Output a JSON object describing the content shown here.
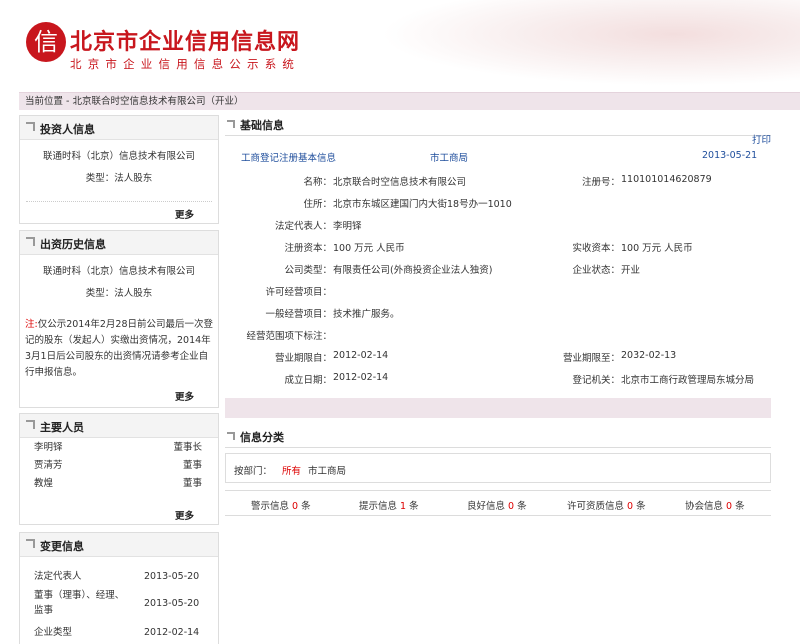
{
  "header": {
    "logo_char": "信",
    "title": "北京市企业信用信息网",
    "subtitle": "北京市企业信用信息公示系统"
  },
  "breadcrumb": "当前位置 - 北京联合时空信息技术有限公司（开业）",
  "left": {
    "investor": {
      "title": "投资人信息",
      "name": "联通时科（北京）信息技术有限公司",
      "type": "类型：法人股东",
      "more": "更多"
    },
    "history": {
      "title": "出资历史信息",
      "name": "联通时科（北京）信息技术有限公司",
      "type": "类型：法人股东",
      "note_prefix": "注:",
      "note_text": "仅公示2014年2月28日前公司最后一次登记的股东（发起人）实缴出资情况，2014年3月1日后公司股东的出资情况请参考企业自行申报信息。",
      "more": "更多"
    },
    "staff": {
      "title": "主要人员",
      "rows": [
        {
          "name": "李明铎",
          "role": "董事长"
        },
        {
          "name": "贾清芳",
          "role": "董事"
        },
        {
          "name": "教煌",
          "role": "董事"
        }
      ],
      "more": "更多"
    },
    "changes": {
      "title": "变更信息",
      "rows": [
        {
          "name": "法定代表人",
          "date": "2013-05-20"
        },
        {
          "name": "董事（理事）、经理、监事",
          "date": "2013-05-20"
        },
        {
          "name": "企业类型",
          "date": "2012-02-14"
        }
      ]
    }
  },
  "basic": {
    "title": "基础信息",
    "print": "打印",
    "reg_link": "工商登记注册基本信息",
    "authority_link": "市工商局",
    "date": "2013-05-21",
    "fields": {
      "name_label": "名称：",
      "name_value": "北京联合时空信息技术有限公司",
      "regno_label": "注册号：",
      "regno_value": "110101014620879",
      "addr_label": "住所：",
      "addr_value": "北京市东城区建国门内大街18号办一1010",
      "rep_label": "法定代表人：",
      "rep_value": "李明铎",
      "capital_label": "注册资本：",
      "capital_value": "100 万元 人民币",
      "paid_label": "实收资本：",
      "paid_value": "100 万元 人民币",
      "type_label": "公司类型：",
      "type_value": "有限责任公司(外商投资企业法人独资)",
      "status_label": "企业状态：",
      "status_value": "开业",
      "permit_label": "许可经营项目：",
      "general_label": "一般经营项目：",
      "general_value": "技术推广服务。",
      "scope_label": "经营范围项下标注：",
      "from_label": "营业期限自：",
      "from_value": "2012-02-14",
      "to_label": "营业期限至：",
      "to_value": "2032-02-13",
      "est_label": "成立日期：",
      "est_value": "2012-02-14",
      "office_label": "登记机关：",
      "office_value": "北京市工商行政管理局东城分局"
    }
  },
  "classify": {
    "title": "信息分类",
    "dept_label": "按部门：",
    "dept_all": "所有",
    "dept_bureau": "市工商局",
    "stats": [
      {
        "label": "警示信息",
        "count": "0",
        "unit": "条"
      },
      {
        "label": "提示信息",
        "count": "1",
        "unit": "条"
      },
      {
        "label": "良好信息",
        "count": "0",
        "unit": "条"
      },
      {
        "label": "许可资质信息",
        "count": "0",
        "unit": "条"
      },
      {
        "label": "协会信息",
        "count": "0",
        "unit": "条"
      }
    ]
  }
}
